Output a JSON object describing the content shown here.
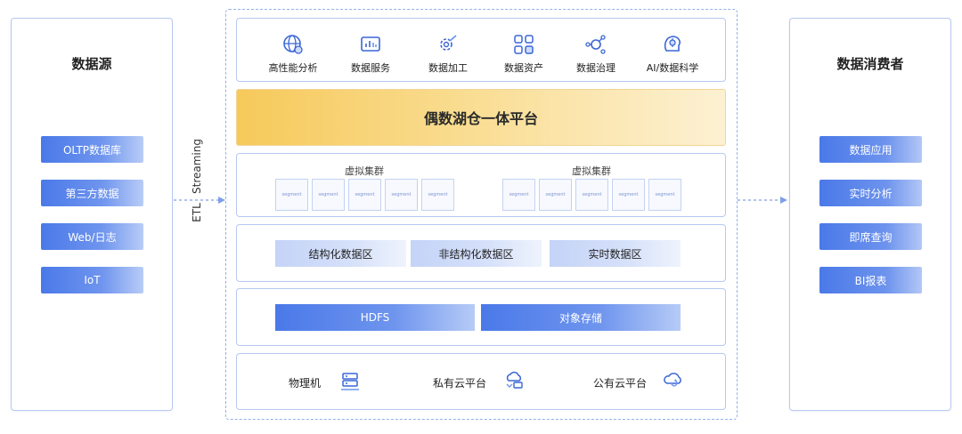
{
  "left_panel": {
    "title": "数据源",
    "items": [
      "OLTP数据库",
      "第三方数据",
      "Web/日志",
      "IoT"
    ]
  },
  "right_panel": {
    "title": "数据消费者",
    "items": [
      "数据应用",
      "实时分析",
      "即席查询",
      "BI报表"
    ]
  },
  "flow": {
    "etl_label": "ETL",
    "streaming_label": "Streaming"
  },
  "capabilities": [
    {
      "label": "高性能分析",
      "icon": "globe-analysis-icon"
    },
    {
      "label": "数据服务",
      "icon": "chart-service-icon"
    },
    {
      "label": "数据加工",
      "icon": "processing-icon"
    },
    {
      "label": "数据资产",
      "icon": "asset-grid-icon"
    },
    {
      "label": "数据治理",
      "icon": "governance-icon"
    },
    {
      "label": "AI/数据科学",
      "icon": "ai-science-icon"
    }
  ],
  "banner": {
    "title": "偶数湖仓一体平台"
  },
  "clusters": {
    "title_left": "虚拟集群",
    "title_right": "虚拟集群",
    "segment_label": "segment"
  },
  "zones": [
    "结构化数据区",
    "非结构化数据区",
    "实时数据区"
  ],
  "storage": [
    "HDFS",
    "对象存储"
  ],
  "infrastructure": [
    {
      "label": "物理机",
      "icon": "server-icon"
    },
    {
      "label": "私有云平台",
      "icon": "private-cloud-icon"
    },
    {
      "label": "公有云平台",
      "icon": "public-cloud-icon"
    }
  ],
  "colors": {
    "accent_blue": "#4a79e8",
    "banner_gold": "#f6c95a",
    "border": "#b7c8f0"
  }
}
